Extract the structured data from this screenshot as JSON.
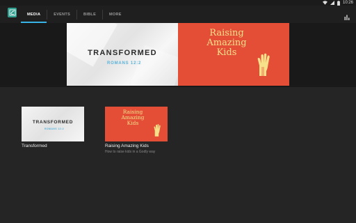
{
  "status_bar": {
    "time": "10:26",
    "icons": [
      "wifi-icon",
      "signal-icon",
      "battery-icon"
    ]
  },
  "app_bar": {
    "logo_icon": "app-logo-icon",
    "tabs": [
      {
        "label": "MEDIA",
        "active": true
      },
      {
        "label": "EVENTS",
        "active": false
      },
      {
        "label": "BIBLE",
        "active": false
      },
      {
        "label": "MORE",
        "active": false
      }
    ],
    "action_icon": "bar-chart-icon"
  },
  "hero": {
    "left_title": "TRANSFORMED",
    "left_subtitle": "ROMANS 12:2",
    "right_lines": [
      "Raising",
      "Amazing",
      "Kids"
    ]
  },
  "media_cards": [
    {
      "thumb_title": "TRANSFORMED",
      "thumb_subtitle": "ROMANS 12:2",
      "title": "Transformed",
      "subtitle": ""
    },
    {
      "thumb_lines": [
        "Raising",
        "Amazing",
        "Kids"
      ],
      "title": "Raising Amazing Kids",
      "subtitle": "How to raise kids in a Godly way"
    }
  ],
  "colors": {
    "accent": "#38b3e6",
    "brand": "#2e9e8e",
    "banner_red": "#e44e36",
    "banner_text": "#f6e08a"
  }
}
